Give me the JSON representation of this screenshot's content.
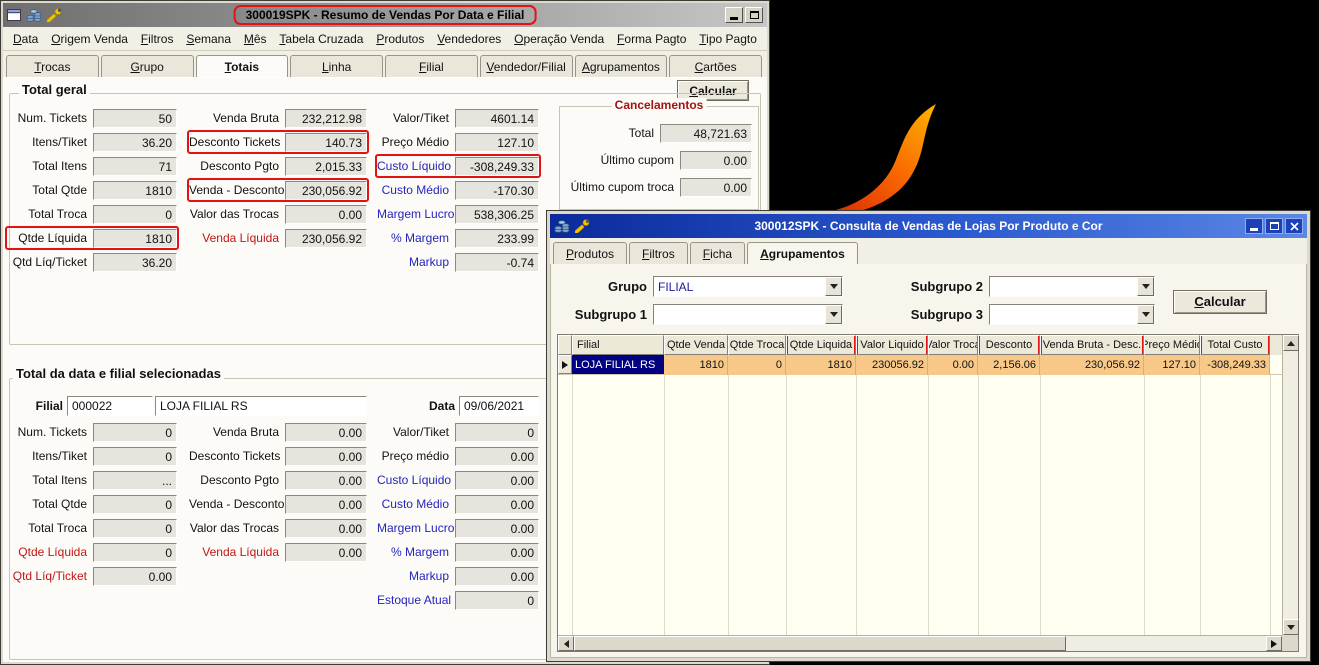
{
  "colors": {
    "annotation_red": "#E21313",
    "win2_title_from": "#0B2A9A",
    "win2_title_to": "#5B87E4",
    "grid_row_highlight": "#F7C888",
    "grid_selected_cell": "#000080",
    "label_blue": "#2424BC",
    "label_red": "#C21515"
  },
  "win1": {
    "title": "300019SPK - Resumo de Vendas Por Data e Filial",
    "icons": [
      "form-icon",
      "coins-icon",
      "wrench-icon"
    ],
    "menus": [
      "Data",
      "Origem Venda",
      "Filtros",
      "Semana",
      "Mês",
      "Tabela Cruzada",
      "Produtos",
      "Vendedores",
      "Operação Venda",
      "Forma Pagto",
      "Tipo Pagto"
    ],
    "tabs": [
      {
        "label": "Trocas"
      },
      {
        "label": "Grupo"
      },
      {
        "label": "Totais",
        "cls": "active"
      },
      {
        "label": "Linha"
      },
      {
        "label": "Filial"
      },
      {
        "label": "Vendedor/Filial"
      },
      {
        "label": "Agrupamentos"
      },
      {
        "label": "Cartões"
      }
    ],
    "calc_btn": "Calcular",
    "total_geral": {
      "title": "Total geral",
      "col1": [
        {
          "label": "Num. Tickets",
          "value": "50"
        },
        {
          "label": "Itens/Tiket",
          "value": "36.20"
        },
        {
          "label": "Total Itens",
          "value": "71"
        },
        {
          "label": "Total Qtde",
          "value": "1810"
        },
        {
          "label": "Total Troca",
          "value": "0"
        },
        {
          "label": "Qtde Líquida",
          "value": "1810",
          "cls": "annot"
        },
        {
          "label": "Qtd Líq/Ticket",
          "value": "36.20"
        }
      ],
      "col2": [
        {
          "label": "Venda Bruta",
          "value": "232,212.98"
        },
        {
          "label": "Desconto Tickets",
          "value": "140.73",
          "cls": "annot"
        },
        {
          "label": "Desconto Pgto",
          "value": "2,015.33"
        },
        {
          "label": "Venda - Desconto",
          "value": "230,056.92",
          "cls": "annot"
        },
        {
          "label": "Valor das Trocas",
          "value": "0.00"
        },
        {
          "label": "Venda Líquida",
          "value": "230,056.92",
          "lc": "red"
        }
      ],
      "col3": [
        {
          "label": "Valor/Tiket",
          "value": "4601.14"
        },
        {
          "label": "Preço Médio",
          "value": "127.10"
        },
        {
          "label": "Custo Líquido",
          "value": "-308,249.33",
          "lc": "blue",
          "cls": "annot"
        },
        {
          "label": "Custo Médio",
          "value": "-170.30",
          "lc": "blue"
        },
        {
          "label": "Margem Lucro",
          "value": "538,306.25",
          "lc": "blue"
        },
        {
          "label": "% Margem",
          "value": "233.99",
          "lc": "blue"
        },
        {
          "label": "Markup",
          "value": "-0.74",
          "lc": "blue"
        }
      ],
      "cancel": {
        "title": "Cancelamentos",
        "rows": [
          {
            "label": "Total",
            "value": "48,721.63"
          },
          {
            "label": "Último cupom",
            "value": "0.00"
          },
          {
            "label": "Último cupom troca",
            "value": "0.00"
          }
        ]
      }
    },
    "total_data": {
      "title": "Total da data e filial selecionadas",
      "filial_label": "Filial",
      "filial_code": "000022",
      "filial_name": "LOJA FILIAL RS",
      "data_label": "Data",
      "data_value": "09/06/2021",
      "col1": [
        {
          "label": "Num. Tickets",
          "value": "0"
        },
        {
          "label": "Itens/Tiket",
          "value": "0"
        },
        {
          "label": "Total Itens",
          "value": "..."
        },
        {
          "label": "Total Qtde",
          "value": "0"
        },
        {
          "label": "Total Troca",
          "value": "0"
        },
        {
          "label": "Qtde Líquida",
          "value": "0",
          "lc": "red"
        },
        {
          "label": "Qtd Líq/Ticket",
          "value": "0.00",
          "lc": "red"
        }
      ],
      "col2": [
        {
          "label": "Venda Bruta",
          "value": "0.00"
        },
        {
          "label": "Desconto Tickets",
          "value": "0.00"
        },
        {
          "label": "Desconto Pgto",
          "value": "0.00"
        },
        {
          "label": "Venda - Desconto",
          "value": "0.00"
        },
        {
          "label": "Valor das Trocas",
          "value": "0.00"
        },
        {
          "label": "Venda Líquida",
          "value": "0.00",
          "lc": "red"
        }
      ],
      "col3": [
        {
          "label": "Valor/Tiket",
          "value": "0"
        },
        {
          "label": "Preço médio",
          "value": "0.00"
        },
        {
          "label": "Custo Líquido",
          "value": "0.00",
          "lc": "blue"
        },
        {
          "label": "Custo Médio",
          "value": "0.00",
          "lc": "blue"
        },
        {
          "label": "Margem Lucro",
          "value": "0.00",
          "lc": "blue"
        },
        {
          "label": "% Margem",
          "value": "0.00",
          "lc": "blue"
        },
        {
          "label": "Markup",
          "value": "0.00",
          "lc": "blue"
        },
        {
          "label": "Estoque Atual",
          "value": "0",
          "lc": "blue"
        }
      ]
    }
  },
  "win2": {
    "title": "300012SPK - Consulta de Vendas de Lojas Por Produto e Cor",
    "icons": [
      "coins-icon",
      "wrench-icon"
    ],
    "tabs": [
      {
        "label": "Produtos"
      },
      {
        "label": "Filtros"
      },
      {
        "label": "Ficha"
      },
      {
        "label": "Agrupamentos",
        "cls": "active"
      }
    ],
    "fields": {
      "grupo_label": "Grupo",
      "grupo_value": "FILIAL",
      "sub1_label": "Subgrupo 1",
      "sub1_value": "",
      "sub2_label": "Subgrupo 2",
      "sub2_value": "",
      "sub3_label": "Subgrupo 3",
      "sub3_value": "",
      "calc_btn": "Calcular"
    },
    "grid": {
      "columns": [
        {
          "label": "Filial"
        },
        {
          "label": "Qtde Venda"
        },
        {
          "label": "Qtde Troca"
        },
        {
          "label": "Qtde Liquida",
          "cls": "annot"
        },
        {
          "label": "Valor Liquido",
          "cls": "annot"
        },
        {
          "label": "Valor Troca"
        },
        {
          "label": "Desconto",
          "cls": "annot"
        },
        {
          "label": "Venda Bruta - Desc.",
          "cls": "annot"
        },
        {
          "label": "Preço Médio"
        },
        {
          "label": "Total Custo",
          "cls": "annot"
        }
      ],
      "row": {
        "filial": "LOJA FILIAL RS",
        "cells": [
          "1810",
          "0",
          "1810",
          "230056.92",
          "0.00",
          "2,156.06",
          "230,056.92",
          "127.10",
          "-308,249.33"
        ]
      }
    }
  }
}
